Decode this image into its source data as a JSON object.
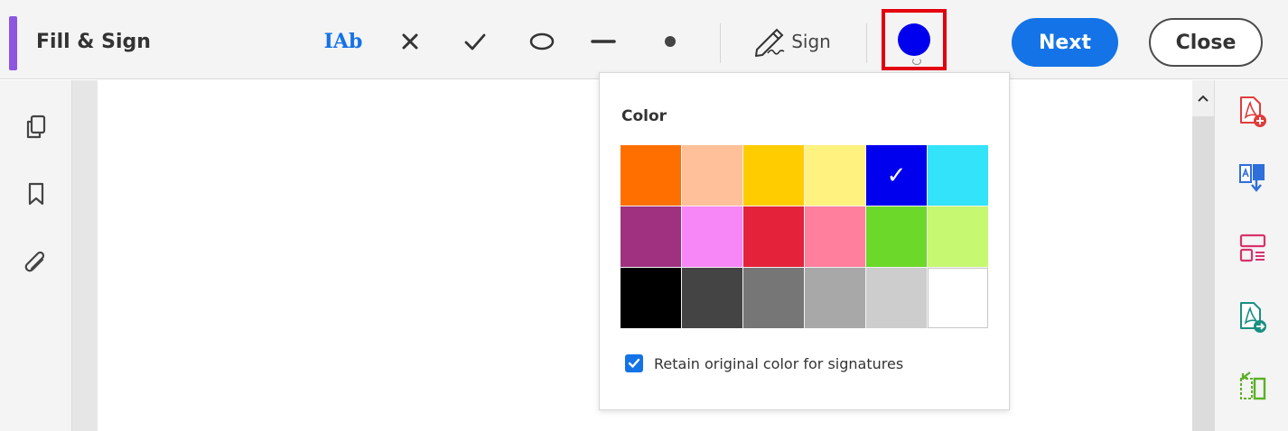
{
  "toolbar": {
    "title": "Fill & Sign",
    "tools": {
      "add_text": "IAb",
      "cross": "cross-mark-tool",
      "check": "check-mark-tool",
      "ellipse": "ellipse-tool",
      "line": "line-tool",
      "dot": "dot-tool"
    },
    "sign_label": "Sign",
    "current_color": "#0000ee",
    "next_label": "Next",
    "close_label": "Close",
    "accent_color": "#8d55e0",
    "primary_color": "#1473e6"
  },
  "color_popover": {
    "title": "Color",
    "swatches": [
      {
        "color": "#ff6f00",
        "selected": false
      },
      {
        "color": "#ffc09a",
        "selected": false
      },
      {
        "color": "#ffcc00",
        "selected": false
      },
      {
        "color": "#fff27e",
        "selected": false
      },
      {
        "color": "#0000ee",
        "selected": true
      },
      {
        "color": "#33e3f9",
        "selected": false
      },
      {
        "color": "#a03080",
        "selected": false
      },
      {
        "color": "#f786f6",
        "selected": false
      },
      {
        "color": "#e4223a",
        "selected": false
      },
      {
        "color": "#ff7f9c",
        "selected": false
      },
      {
        "color": "#6bd82a",
        "selected": false
      },
      {
        "color": "#c6f871",
        "selected": false
      },
      {
        "color": "#000000",
        "selected": false
      },
      {
        "color": "#444444",
        "selected": false
      },
      {
        "color": "#767676",
        "selected": false
      },
      {
        "color": "#a8a8a8",
        "selected": false
      },
      {
        "color": "#cdcdcd",
        "selected": false
      },
      {
        "color": "#ffffff",
        "selected": false
      }
    ],
    "retain_label": "Retain original color for signatures",
    "retain_checked": true
  },
  "left_rail": {
    "icons": [
      "pages-icon",
      "bookmark-icon",
      "attachment-icon"
    ]
  },
  "right_rail": {
    "icons": [
      "create-pdf-icon",
      "export-pdf-icon",
      "edit-pdf-icon",
      "send-for-sign-icon",
      "organize-pages-icon"
    ]
  }
}
